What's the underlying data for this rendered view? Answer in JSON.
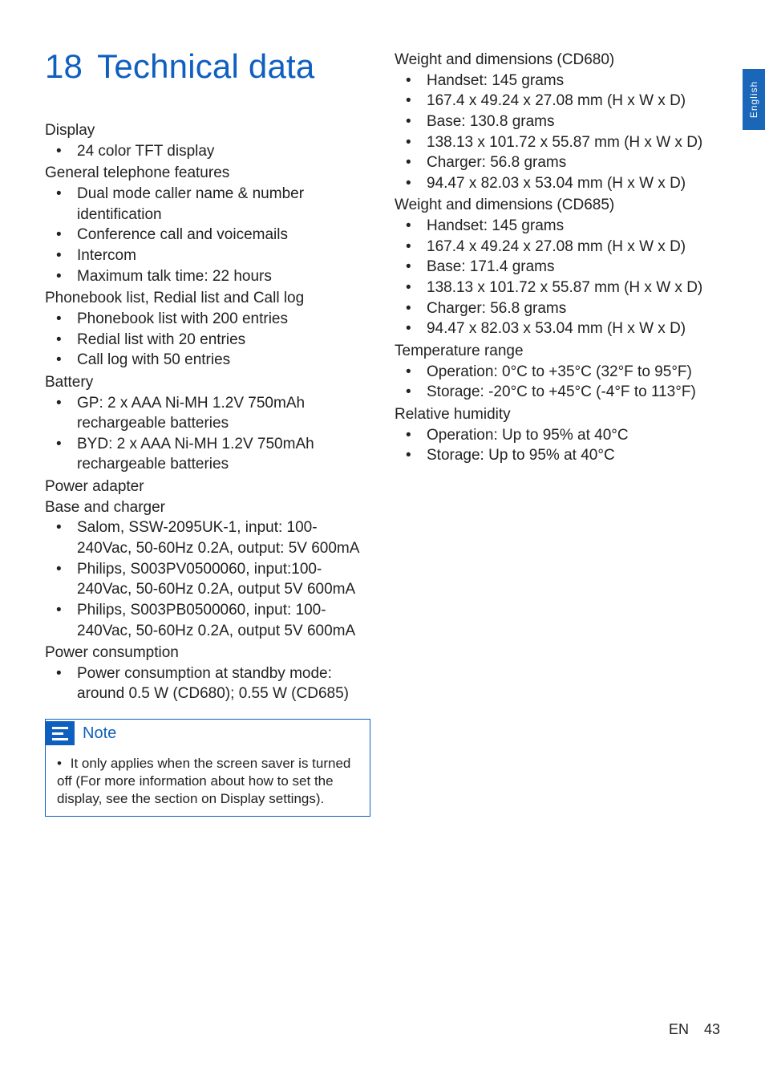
{
  "sideTab": "English",
  "title": {
    "number": "18",
    "text": "Technical data"
  },
  "left": {
    "sections": [
      {
        "heading": "Display",
        "items": [
          "24 color TFT display"
        ]
      },
      {
        "heading": "General telephone features",
        "items": [
          "Dual mode caller name & number identification",
          "Conference call and voicemails",
          "Intercom",
          "Maximum talk time: 22 hours"
        ]
      },
      {
        "heading": "Phonebook list, Redial list and Call log",
        "items": [
          "Phonebook list with 200 entries",
          "Redial list with 20 entries",
          "Call log with 50 entries"
        ]
      },
      {
        "heading": "Battery",
        "items": [
          "GP: 2 x AAA Ni-MH 1.2V 750mAh rechargeable batteries",
          "BYD: 2 x AAA Ni-MH 1.2V 750mAh rechargeable batteries"
        ]
      },
      {
        "heading": "Power adapter",
        "sub": "Base and charger",
        "items": [
          "Salom, SSW-2095UK-1, input: 100-240Vac, 50-60Hz 0.2A, output: 5V 600mA",
          "Philips, S003PV0500060, input:100-240Vac, 50-60Hz 0.2A, output 5V 600mA",
          "Philips, S003PB0500060, input: 100-240Vac, 50-60Hz 0.2A, output 5V 600mA"
        ]
      },
      {
        "heading": "Power consumption",
        "items": [
          "Power consumption at standby mode: around 0.5 W (CD680); 0.55 W (CD685)"
        ]
      }
    ],
    "note": {
      "title": "Note",
      "body": "It only applies when the screen saver is turned off (For more information about how to set the display, see the section on Display settings)."
    }
  },
  "right": {
    "sections": [
      {
        "heading": "Weight and dimensions (CD680)",
        "items": [
          "Handset: 145 grams",
          "167.4 x 49.24 x 27.08 mm (H x W x D)",
          "Base: 130.8 grams",
          "138.13 x 101.72 x 55.87 mm (H x W x D)",
          "Charger: 56.8 grams",
          "94.47 x 82.03 x 53.04 mm (H x W x D)"
        ]
      },
      {
        "heading": "Weight and dimensions (CD685)",
        "items": [
          "Handset: 145 grams",
          "167.4 x 49.24 x 27.08 mm (H x W x D)",
          "Base: 171.4 grams",
          "138.13 x 101.72 x 55.87 mm (H x W x D)",
          "Charger: 56.8 grams",
          "94.47 x 82.03 x 53.04 mm (H x W x D)"
        ]
      },
      {
        "heading": "Temperature range",
        "items": [
          "Operation: 0°C to +35°C (32°F to 95°F)",
          "Storage: -20°C to +45°C (-4°F to 113°F)"
        ]
      },
      {
        "heading": "Relative humidity",
        "items": [
          "Operation: Up to 95% at 40°C",
          "Storage: Up to 95% at 40°C"
        ]
      }
    ]
  },
  "footer": {
    "lang": "EN",
    "page": "43"
  }
}
